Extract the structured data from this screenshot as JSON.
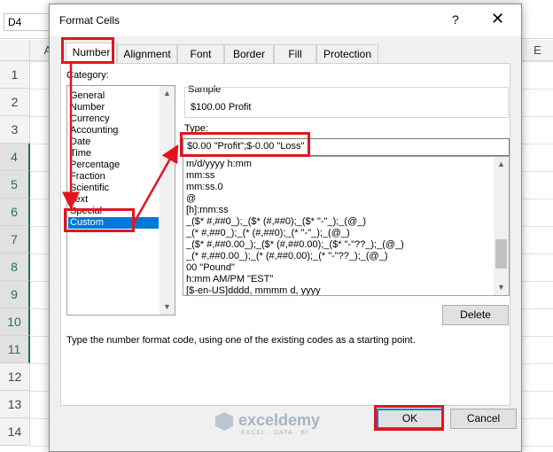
{
  "excel": {
    "name_box": "D4",
    "columns": [
      "A",
      "E"
    ],
    "rows": [
      "1",
      "2",
      "3",
      "4",
      "5",
      "6",
      "7",
      "8",
      "9",
      "10",
      "11",
      "12",
      "13",
      "14"
    ]
  },
  "dialog": {
    "title": "Format Cells",
    "help": "?",
    "close": "✕",
    "tabs": [
      "Number",
      "Alignment",
      "Font",
      "Border",
      "Fill",
      "Protection"
    ],
    "active_tab": "Number",
    "category_label": "Category:",
    "categories": [
      "General",
      "Number",
      "Currency",
      "Accounting",
      "Date",
      "Time",
      "Percentage",
      "Fraction",
      "Scientific",
      "Text",
      "Special",
      "Custom"
    ],
    "selected_category": "Custom",
    "sample_label": "Sample",
    "sample_value": "$100.00 Profit",
    "type_label": "Type:",
    "type_value": "$0.00 \"Profit\";$-0.00 \"Loss\"",
    "formats": [
      "m/d/yyyy h:mm",
      "mm:ss",
      "mm:ss.0",
      "@",
      "[h]:mm:ss",
      "_($* #,##0_);_($* (#,##0);_($* \"-\"_);_(@_)",
      "_(* #,##0_);_(* (#,##0);_(* \"-\"_);_(@_)",
      "_($* #,##0.00_);_($* (#,##0.00);_($* \"-\"??_);_(@_)",
      "_(* #,##0.00_);_(* (#,##0.00);_(* \"-\"??_);_(@_)",
      "00 \"Pound\"",
      "h:mm AM/PM \"EST\"",
      "[$-en-US]dddd, mmmm d, yyyy"
    ],
    "delete_label": "Delete",
    "hint": "Type the number format code, using one of the existing codes as a starting point.",
    "ok_label": "OK",
    "cancel_label": "Cancel"
  },
  "watermark": {
    "brand": "exceldemy",
    "tagline": "EXCEL · DATA · BI"
  },
  "colors": {
    "annotation_red": "#e2151d",
    "selection_blue": "#0078d7",
    "excel_green": "#217346"
  },
  "icons": [
    "scroll-up-arrow-icon",
    "scroll-down-arrow-icon",
    "exceldemy-logo-icon"
  ]
}
